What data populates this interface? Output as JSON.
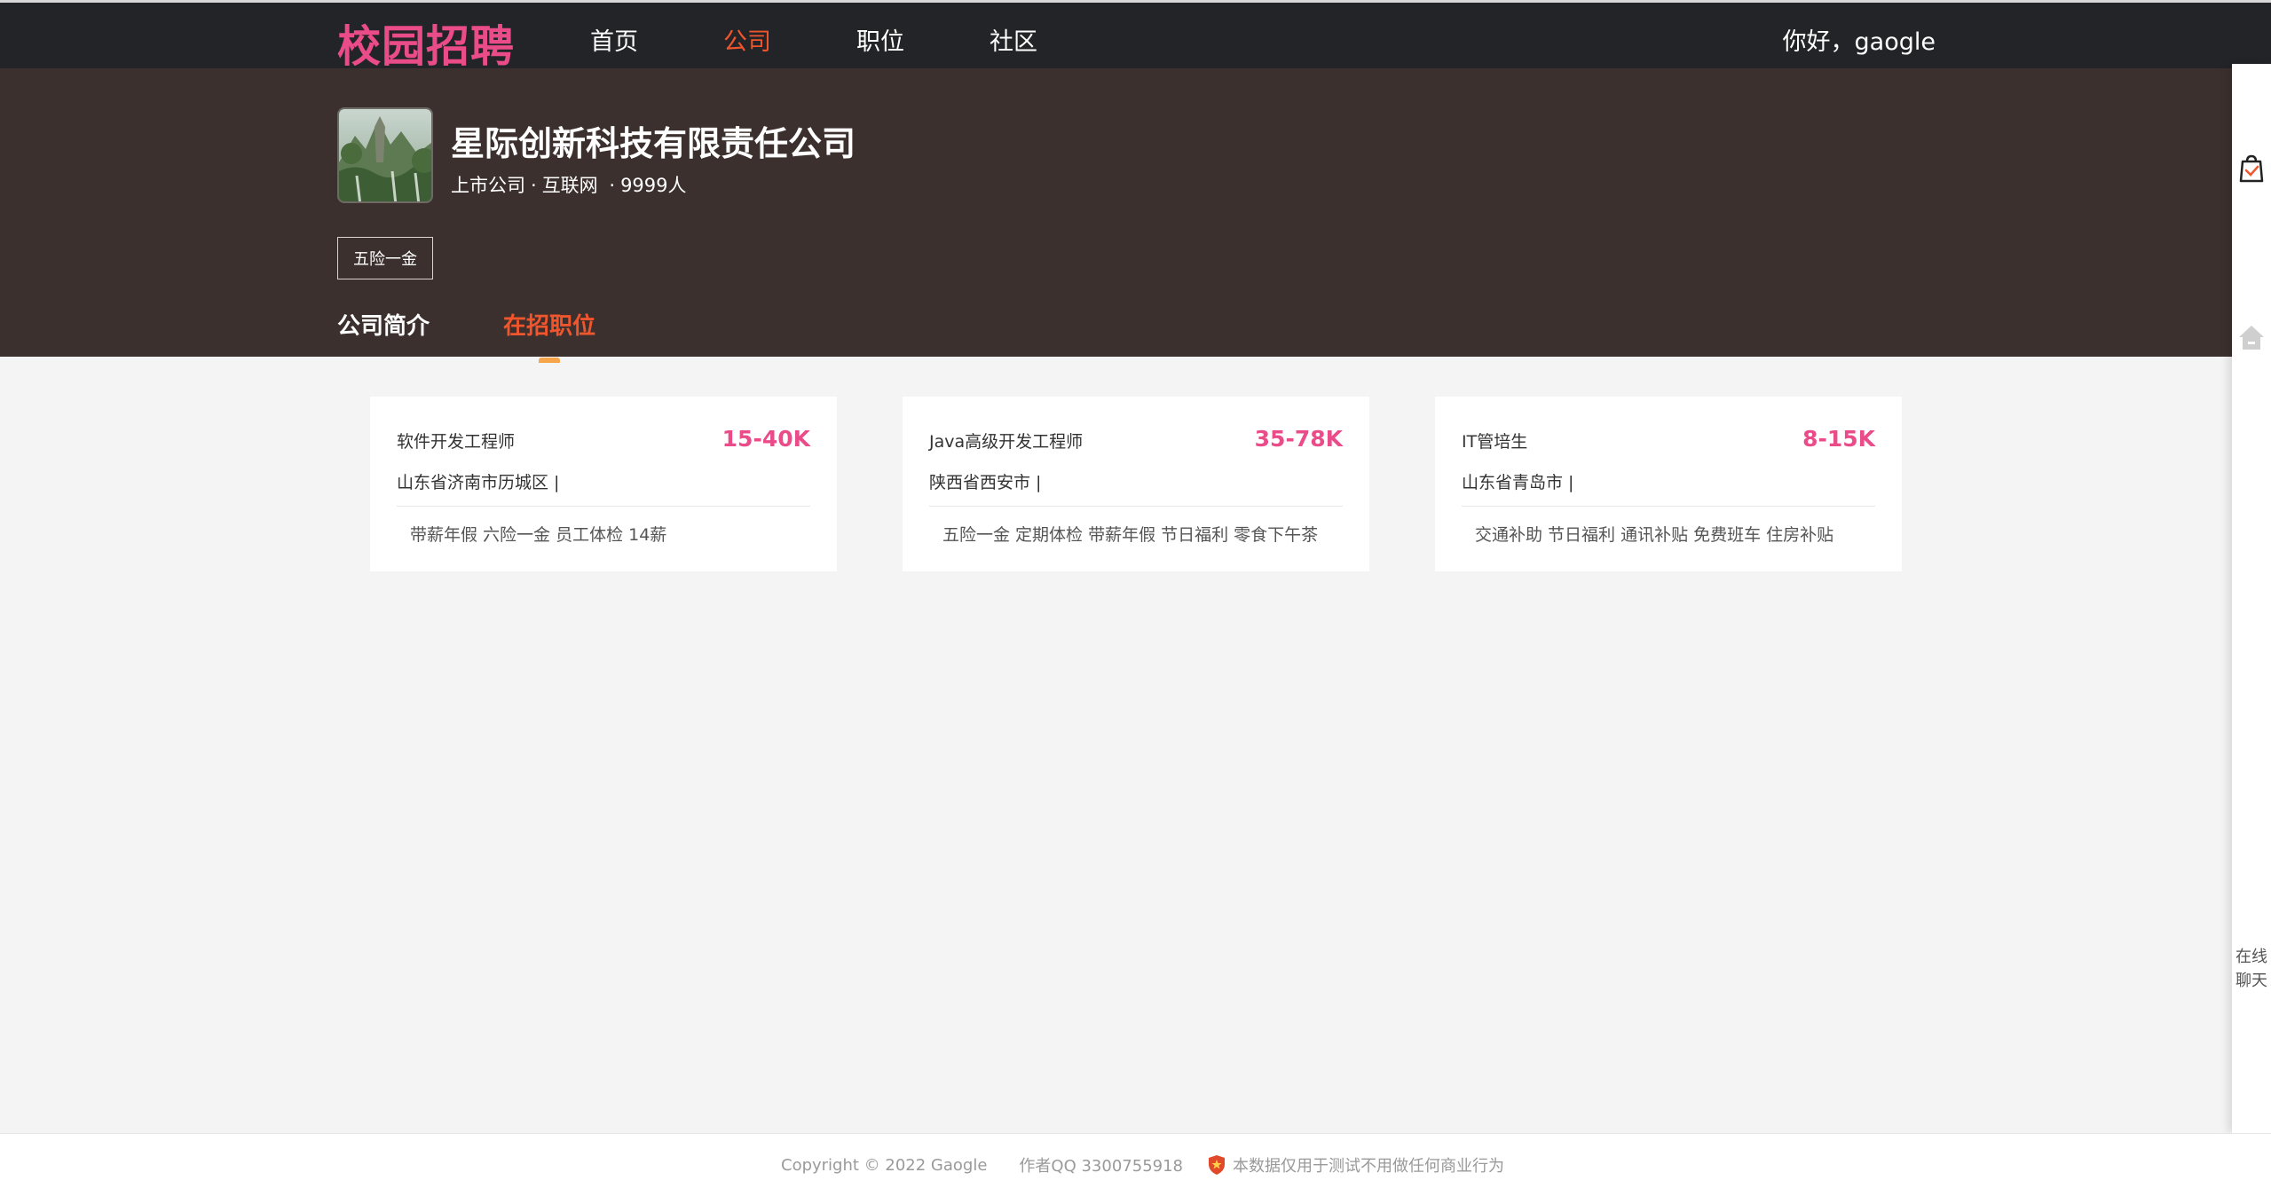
{
  "nav": {
    "logo": "校园招聘",
    "items": [
      {
        "label": "首页",
        "active": false
      },
      {
        "label": "公司",
        "active": true
      },
      {
        "label": "职位",
        "active": false
      },
      {
        "label": "社区",
        "active": false
      }
    ],
    "greeting": "你好，gaogle"
  },
  "company": {
    "name": "星际创新科技有限责任公司",
    "meta": [
      "上市公司",
      "·",
      "互联网",
      "·",
      "9999人"
    ],
    "tag": "五险一金",
    "tabs": [
      {
        "label": "公司简介",
        "active": false
      },
      {
        "label": "在招职位",
        "active": true
      }
    ]
  },
  "jobs": [
    {
      "title": "软件开发工程师",
      "salary": "15-40K",
      "location": "山东省济南市历城区 |",
      "benefits": "带薪年假 六险一金 员工体检 14薪"
    },
    {
      "title": "Java高级开发工程师",
      "salary": "35-78K",
      "location": "陕西省西安市 |",
      "benefits": "五险一金 定期体检 带薪年假 节日福利 零食下午茶"
    },
    {
      "title": "IT管培生",
      "salary": "8-15K",
      "location": "山东省青岛市 |",
      "benefits": "交通补助 节日福利 通讯补贴 免费班车 住房补贴"
    }
  ],
  "sidebar": {
    "icons": [
      "cart-icon",
      "home-icon"
    ],
    "chat_line1": "在线",
    "chat_line2": "聊天"
  },
  "footer": {
    "copyright": "Copyright © 2022 Gaogle",
    "qq": "作者QQ 3300755918",
    "notice": "本数据仅用于测试不用做任何商业行为"
  },
  "colors": {
    "accent_pink": "#ea4c89",
    "accent_orange": "#f0562d",
    "topbar_bg": "#232427",
    "header_bg": "#3b302e"
  }
}
